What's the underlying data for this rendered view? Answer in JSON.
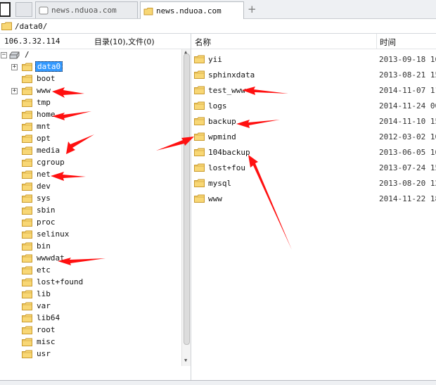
{
  "tabs": {
    "inactive_label": "news.nduoa.com",
    "active_label": "news.nduoa.com",
    "new_tab_symbol": "+"
  },
  "pathbar": {
    "path": "/data0/"
  },
  "left_header": {
    "host": "106.3.32.114",
    "counts": "目录(10),文件(0)"
  },
  "right_header": {
    "name_col": "名称",
    "time_col": "时间"
  },
  "tree": {
    "root_label": "/",
    "items": [
      "data0",
      "boot",
      "www",
      "tmp",
      "home",
      "mnt",
      "opt",
      "media",
      "cgroup",
      "net",
      "dev",
      "sys",
      "sbin",
      "proc",
      "selinux",
      "bin",
      "wwwdat",
      "etc",
      "lost+found",
      "lib",
      "var",
      "lib64",
      "root",
      "misc",
      "usr"
    ]
  },
  "files": [
    {
      "name": "yii",
      "date": "2013-09-18 16"
    },
    {
      "name": "sphinxdata",
      "date": "2013-08-21 15"
    },
    {
      "name": "test_www",
      "date": "2014-11-07 11"
    },
    {
      "name": "logs",
      "date": "2014-11-24 00"
    },
    {
      "name": "backup",
      "date": "2014-11-10 15"
    },
    {
      "name": "wpmind",
      "date": "2012-03-02 10"
    },
    {
      "name": "104backup",
      "date": "2013-06-05 16"
    },
    {
      "name": "lost+fou",
      "date": "2013-07-24 15"
    },
    {
      "name": "mysql",
      "date": "2013-08-20 12"
    },
    {
      "name": "www",
      "date": "2014-11-22 18"
    }
  ],
  "colors": {
    "folder_fill": "#f8d775",
    "folder_edge": "#c99a2e",
    "selection": "#3399ff",
    "arrow": "#ff1010"
  },
  "icons": {
    "folder": "folder-icon",
    "drive": "drive-icon",
    "new_tab": "plus-icon"
  }
}
